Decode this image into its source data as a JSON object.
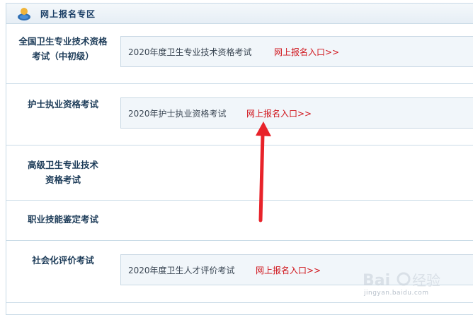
{
  "section": {
    "title": "网上报名专区",
    "icon": "user-icon"
  },
  "rows": [
    {
      "label_lines": [
        "全国卫生专业技术资格",
        "考试（中初级）"
      ],
      "entry": {
        "name": "2020年度卫生专业技术资格考试",
        "link": "网上报名入口>>"
      }
    },
    {
      "label_lines": [
        "护士执业资格考试"
      ],
      "entry": {
        "name": "2020年护士执业资格考试",
        "link": "网上报名入口>>"
      }
    },
    {
      "label_lines": [
        "高级卫生专业技术",
        "资格考试"
      ],
      "entry": null
    },
    {
      "label_lines": [
        "职业技能鉴定考试"
      ],
      "entry": null
    },
    {
      "label_lines": [
        "社会化评价考试"
      ],
      "entry": {
        "name": "2020年度卫生人才评价考试",
        "link": "网上报名入口>>"
      }
    }
  ],
  "annotation": {
    "type": "red-arrow",
    "points_to": "护士执业资格考试 网上报名入口"
  },
  "watermark": {
    "brand": "Baidu经验",
    "url": "jingyan.baidu.com"
  },
  "colors": {
    "label_text": "#1c3b58",
    "link_red": "#d0141b",
    "border": "#c9dbe7",
    "box_bg": "#f1f6fa"
  }
}
